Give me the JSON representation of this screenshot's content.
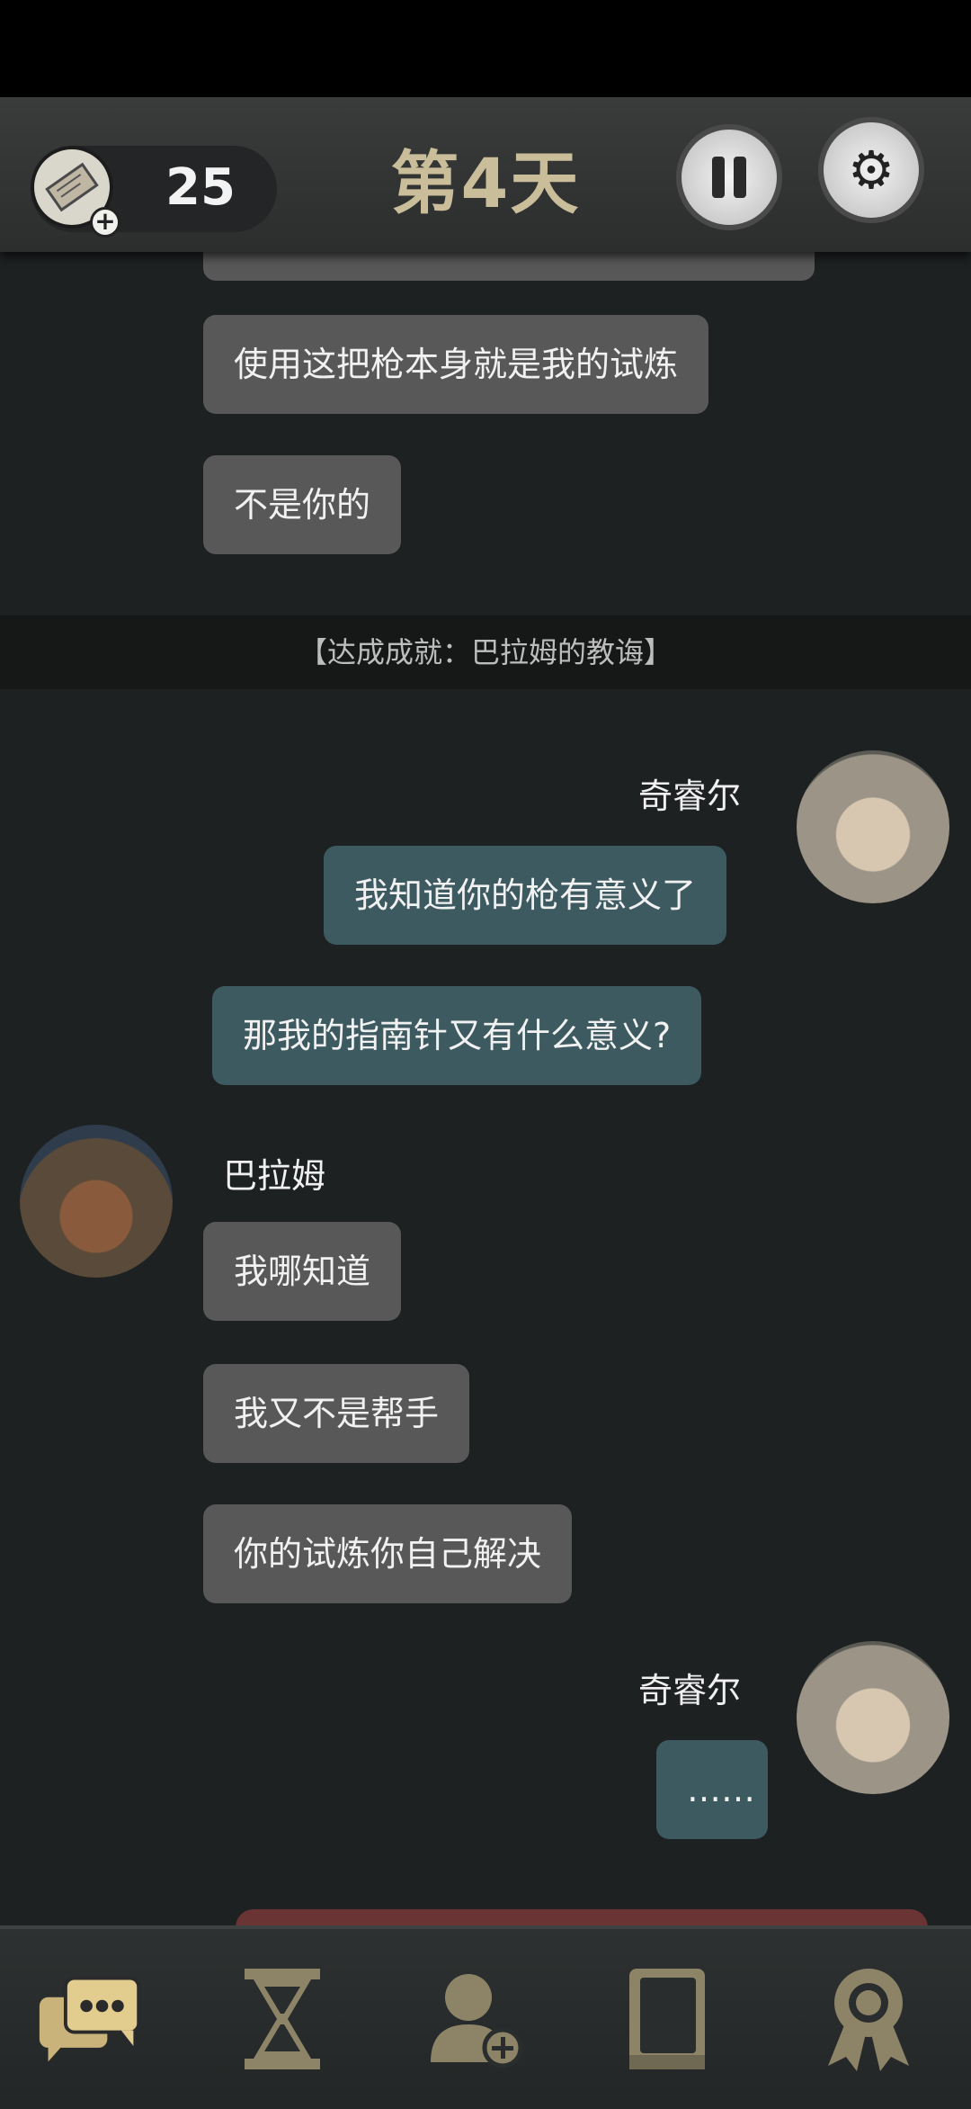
{
  "header": {
    "ticket_count": "25",
    "day_title": "第4天"
  },
  "messages_top": [
    {
      "text": "使用这把枪本身就是我的试炼"
    },
    {
      "text": "不是你的"
    }
  ],
  "achievement_text": "【达成成就：巴拉姆的教诲】",
  "chat": {
    "kizar_name": "奇睿尔",
    "kizar_msg_1": "我知道你的枪有意义了",
    "kizar_msg_2": "那我的指南针又有什么意义?",
    "balam_name": "巴拉姆",
    "balam_msg_1": "我哪知道",
    "balam_msg_2": "我又不是帮手",
    "balam_msg_3": "你的试炼你自己解决",
    "kizar_name_2": "奇睿尔",
    "kizar_msg_3": "……"
  },
  "colors": {
    "left_bubble": "#585858",
    "right_bubble": "#3d5a60",
    "nav_active": "#d8c48a",
    "nav_inactive": "#8d8468"
  },
  "icons": [
    "ticket-icon",
    "pause-icon",
    "gear-icon",
    "chat-icon",
    "hourglass-icon",
    "add-friend-icon",
    "book-icon",
    "achievement-icon"
  ]
}
